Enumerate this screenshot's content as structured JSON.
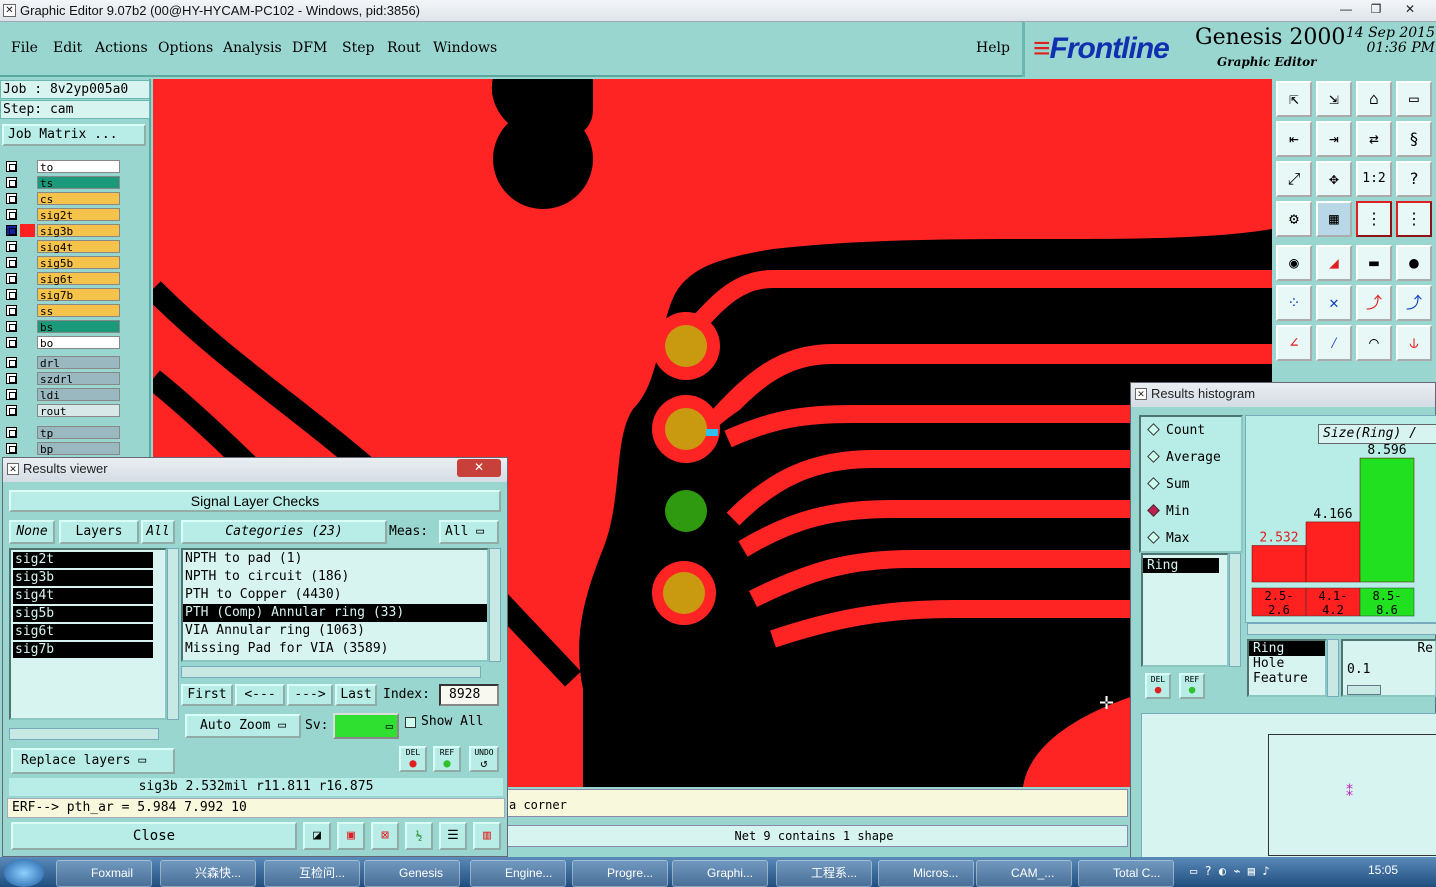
{
  "window": {
    "title": "Graphic Editor 9.07b2 (00@HY-HYCAM-PC102 - Windows, pid:3856)",
    "controls": [
      "—",
      "❐",
      "✕"
    ]
  },
  "menu": {
    "items": [
      "File",
      "Edit",
      "Actions",
      "Options",
      "Analysis",
      "DFM",
      "Step",
      "Rout",
      "Windows"
    ],
    "help": "Help"
  },
  "brand": {
    "logo": "Frontline",
    "product": "Genesis 2000",
    "subtitle": "Graphic Editor",
    "date": "14 Sep 2015",
    "time": "01:36 PM"
  },
  "job": {
    "job_label": "Job : 8v2yp005a0",
    "step_label": "Step: cam",
    "matrix_button": "Job Matrix ..."
  },
  "layers": [
    {
      "name": "to",
      "color": "#ffffff"
    },
    {
      "name": "ts",
      "color": "#1a9a7a"
    },
    {
      "name": "cs",
      "color": "#f5c24a"
    },
    {
      "name": "sig2t",
      "color": "#f5c24a"
    },
    {
      "name": "sig3b",
      "color": "#f5c24a",
      "active": true
    },
    {
      "name": "sig4t",
      "color": "#f5c24a"
    },
    {
      "name": "sig5b",
      "color": "#f5c24a"
    },
    {
      "name": "sig6t",
      "color": "#f5c24a"
    },
    {
      "name": "sig7b",
      "color": "#f5c24a"
    },
    {
      "name": "ss",
      "color": "#f5c24a"
    },
    {
      "name": "bs",
      "color": "#1a9a7a"
    },
    {
      "name": "bo",
      "color": "#ffffff"
    },
    {
      "name": "drl",
      "color": "#9ab8c0"
    },
    {
      "name": "szdrl",
      "color": "#9ab8c0"
    },
    {
      "name": "ldi",
      "color": "#9ab8c0"
    },
    {
      "name": "rout",
      "color": "#d8e8e8"
    },
    {
      "name": "tp",
      "color": "#9ab8c0"
    },
    {
      "name": "bp",
      "color": "#9ab8c0"
    }
  ],
  "results_viewer": {
    "title": "Results viewer",
    "header": "Signal Layer Checks",
    "none_btn": "None",
    "layers_btn": "Layers",
    "all_btn": "All",
    "layer_list": [
      "sig2t",
      "sig3b",
      "sig4t",
      "sig5b",
      "sig6t",
      "sig7b"
    ],
    "categories_label": "Categories (23)",
    "meas_label": "Meas:",
    "meas_value": "All",
    "categories": [
      "NPTH to pad (1)",
      "NPTH to circuit (186)",
      "PTH to Copper (4430)",
      "PTH (Comp) Annular ring (33)",
      "VIA Annular ring (1063)",
      "Missing Pad for VIA (3589)"
    ],
    "selected_index": 3,
    "first_btn": "First",
    "prev_btn": "<---",
    "next_btn": "--->",
    "last_btn": "Last",
    "index_label": "Index:",
    "index_value": "8928",
    "auto_zoom": "Auto Zoom",
    "sv_label": "Sv:",
    "show_all": "Show All",
    "del_btn": "DEL",
    "ref_btn": "REF",
    "undo_btn": "UNDO",
    "replace_layers": "Replace layers",
    "info_line": "sig3b 2.532mil  r11.811  r16.875",
    "erf_line": "ERF--> pth_ar = 5.984 7.992 10",
    "close_btn": "Close"
  },
  "status": {
    "line1": "a corner",
    "line2": "Net 9 contains 1 shape"
  },
  "histogram": {
    "title": "Results histogram",
    "modes": [
      "Count",
      "Average",
      "Sum",
      "Min",
      "Max"
    ],
    "selected_mode": "Min",
    "list_item": "Ring",
    "del_btn": "DEL",
    "ref_btn": "REF",
    "axis_label": "Size(Ring) /",
    "field_list": [
      "Ring",
      "Hole",
      "Feature"
    ],
    "right_label": "Re",
    "value": "0.1"
  },
  "chart_data": {
    "type": "bar",
    "title": "",
    "xlabel": "Size(Ring) /",
    "categories": [
      "2.5-2.6",
      "4.1-4.2",
      "8.5-8.6"
    ],
    "values": [
      2.532,
      4.166,
      8.596
    ],
    "value_labels": [
      "2.532",
      "4.166",
      "8.596"
    ],
    "colors": [
      "#ff2020",
      "#ff2020",
      "#20e020"
    ],
    "ylim": [
      0,
      8.6
    ]
  },
  "taskbar": {
    "items": [
      "Foxmail",
      "兴森快...",
      "互检问...",
      "Genesis",
      "Engine...",
      "Progre...",
      "Graphi...",
      "工程系...",
      "Micros...",
      "CAM_...",
      "Total C..."
    ],
    "clock": "15:05"
  }
}
